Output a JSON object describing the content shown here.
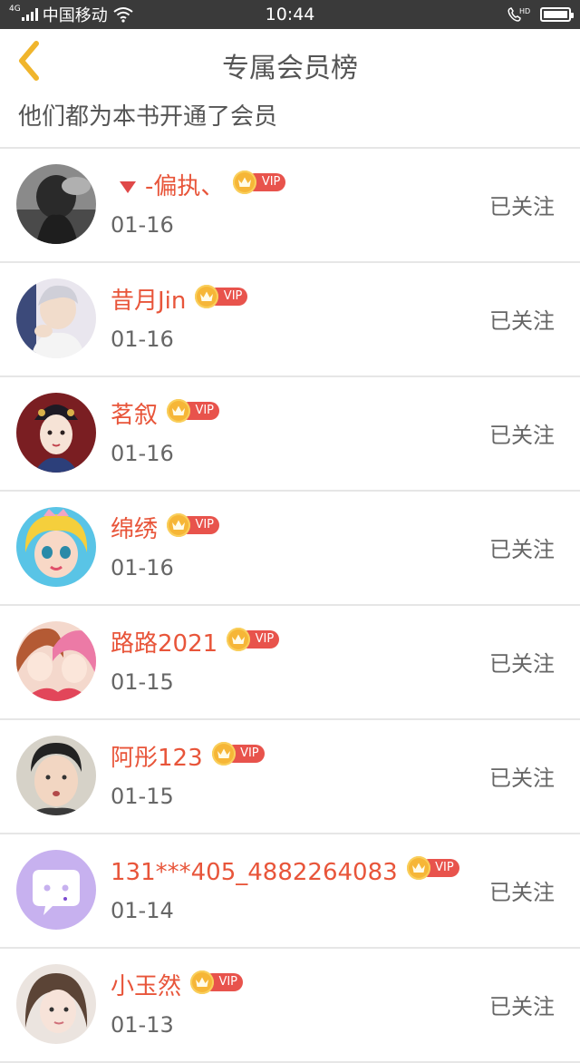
{
  "status_bar": {
    "network": "4G",
    "carrier": "中国移动",
    "time": "10:44",
    "call_badge": "HD"
  },
  "nav": {
    "back_icon": "chevron-left-icon",
    "title": "专属会员榜"
  },
  "subtitle": "他们都为本书开通了会员",
  "colors": {
    "accent": "#e8553a",
    "back_chevron": "#f0b52c",
    "vip_badge": "#e8534c",
    "crown_coin": "#f6b637"
  },
  "vip_label": "VIP",
  "members": [
    {
      "name": "-偏执、",
      "date": "01-16",
      "follow": "已关注",
      "prefix_icon": "red-triangle-icon",
      "avatar": "grayscale-photo"
    },
    {
      "name": "昔月Jin",
      "date": "01-16",
      "follow": "已关注",
      "avatar": "silver-hair-boy"
    },
    {
      "name": "茗叙",
      "date": "01-16",
      "follow": "已关注",
      "avatar": "costume-girl"
    },
    {
      "name": "绵绣",
      "date": "01-16",
      "follow": "已关注",
      "avatar": "cartoon-princess"
    },
    {
      "name": "路路2021",
      "date": "01-15",
      "follow": "已关注",
      "avatar": "anime-girls"
    },
    {
      "name": "阿彤123",
      "date": "01-15",
      "follow": "已关注",
      "avatar": "boy-photo"
    },
    {
      "name": "131***405_4882264083",
      "date": "01-14",
      "follow": "已关注",
      "avatar": "default-chat-avatar"
    },
    {
      "name": "小玉然",
      "date": "01-13",
      "follow": "已关注",
      "avatar": "girl-photo"
    }
  ]
}
